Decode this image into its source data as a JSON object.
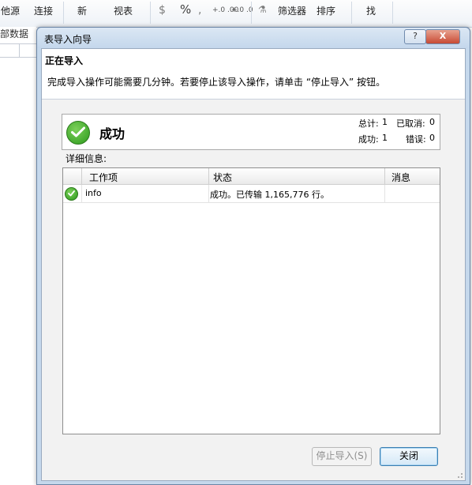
{
  "background": {
    "ribbon": {
      "items": [
        "他源",
        "连接",
        "新",
        "视表",
        "$",
        "%",
        ",",
        "+.0 .00",
        "+.0 .0",
        "筛选器",
        "排序",
        "找"
      ],
      "sheet_label": "部数据"
    }
  },
  "dialog": {
    "title": "表导入向导",
    "help_label": "?",
    "close_label": "X",
    "header": {
      "title": "正在导入",
      "description": "完成导入操作可能需要几分钟。若要停止该导入操作，请单击 “停止导入” 按钮。"
    },
    "status": {
      "text": "成功",
      "total_label": "总计:",
      "total_value": "1",
      "cancelled_label": "已取消:",
      "cancelled_value": "0",
      "success_label": "成功:",
      "success_value": "1",
      "error_label": "错误:",
      "error_value": "0",
      "icon": "check-circle-icon"
    },
    "details_label": "详细信息:",
    "table": {
      "columns": [
        "工作项",
        "状态",
        "消息"
      ],
      "rows": [
        {
          "icon": "check-circle-icon",
          "item": "info",
          "status": "成功。已传输 1,165,776 行。",
          "message": ""
        }
      ]
    },
    "buttons": {
      "stop": "停止导入(S)",
      "close": "关闭"
    }
  },
  "colors": {
    "success_green": "#2c9a1c",
    "title_bar": "#c4d7ec",
    "close_red": "#c74a34"
  }
}
